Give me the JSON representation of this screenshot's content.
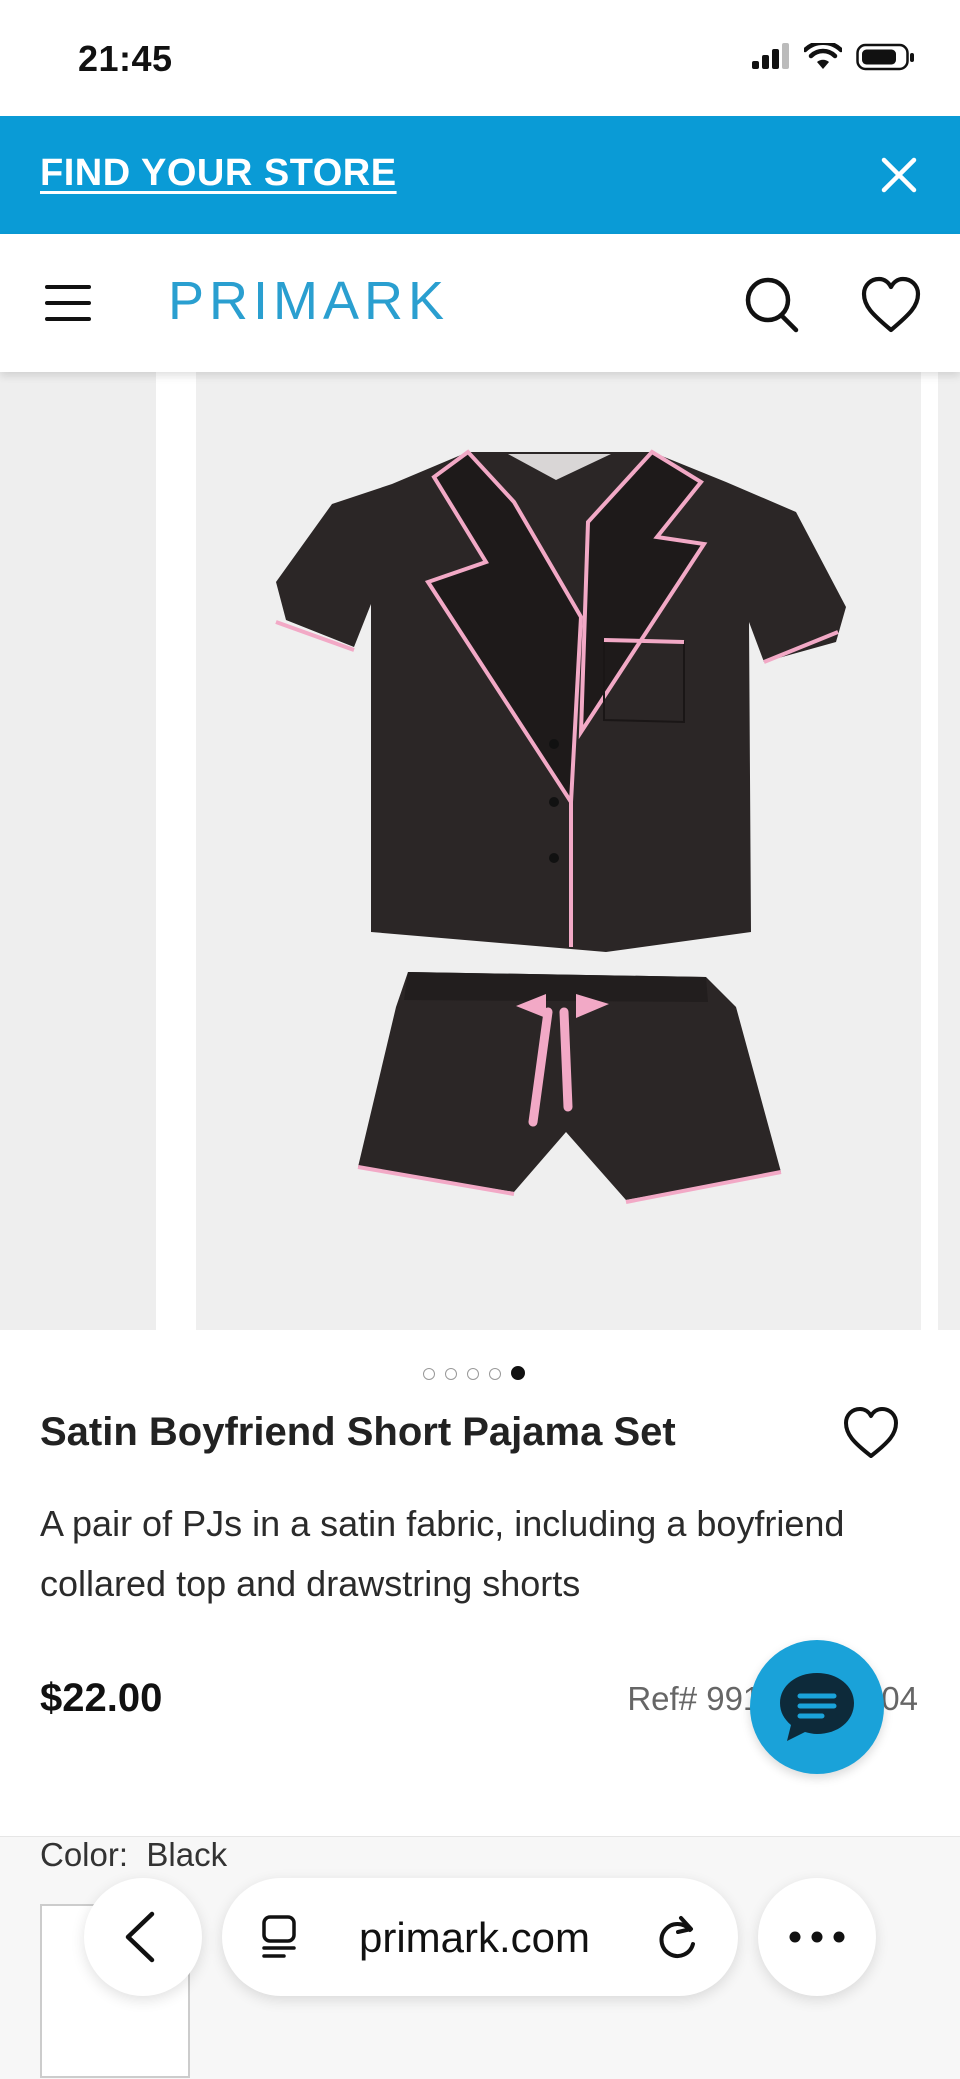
{
  "status_bar": {
    "time": "21:45"
  },
  "banner": {
    "link_label": "FIND YOUR STORE"
  },
  "header": {
    "logo": "PRIMARK"
  },
  "gallery": {
    "total_images": 5,
    "active_index": 5
  },
  "product": {
    "title": "Satin Boyfriend Short Pajama Set",
    "description": "A pair of PJs in a satin fabric, including a boyfriend collared top and drawstring shorts",
    "price": "$22.00",
    "ref": "Ref# 991",
    "ref_tail": "04"
  },
  "color": {
    "label": "Color:",
    "value": "Black"
  },
  "browser": {
    "url": "primark.com"
  },
  "colors": {
    "banner": "#0a9bd6",
    "logo": "#2a9fd0",
    "chat_fab": "#1aa2d9",
    "garment": "#2b2626",
    "piping": "#f2a9c6"
  },
  "icons": [
    "signal-icon",
    "wifi-icon",
    "battery-icon",
    "close-icon",
    "menu-icon",
    "search-icon",
    "heart-icon",
    "chat-icon",
    "back-icon",
    "tabs-icon",
    "reload-icon",
    "more-icon"
  ]
}
